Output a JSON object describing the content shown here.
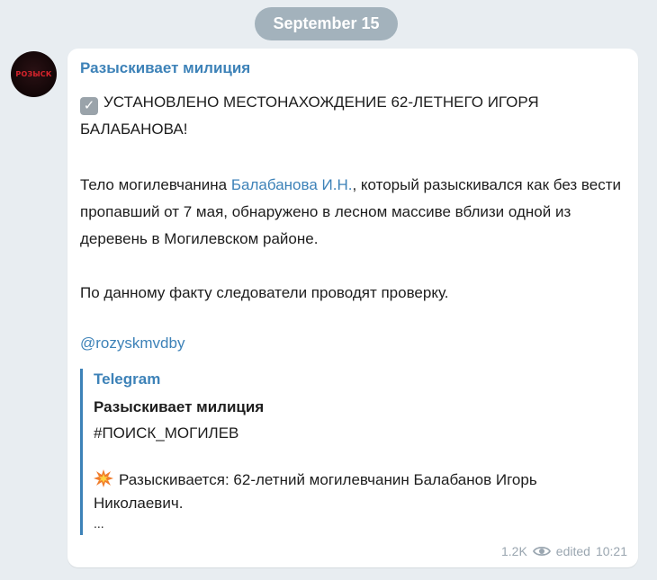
{
  "date_divider": "September 15",
  "channel": {
    "avatar_text": "РОЗЫСК",
    "name": "Разыскивает милиция"
  },
  "message": {
    "headline": "УСТАНОВЛЕНО МЕСТОНАХОЖДЕНИЕ 62-ЛЕТНЕГО ИГОРЯ БАЛАБАНОВА!",
    "p1_before": "Тело могилевчанина ",
    "p1_link": "Балабанова И.Н.",
    "p1_after": ", который разыскивался как без вести пропавший от 7 мая, обнаружено в лесном массиве вблизи одной из деревень в Могилевском районе.",
    "p2": "По данному факту следователи проводят проверку.",
    "channel_link": "@rozyskmvdby"
  },
  "preview": {
    "source": "Telegram",
    "title": "Разыскивает милиция",
    "hashtag": "#ПОИСК_МОГИЛЕВ",
    "text": "Разыскивается: 62-летний могилевчанин Балабанов Игорь Николаевич.",
    "ellipsis": "..."
  },
  "footer": {
    "views": "1.2K",
    "edited": "edited",
    "time": "10:21"
  },
  "colors": {
    "accent": "#3d82b8",
    "background": "#e8edf1",
    "date_pill": "#a3b2bc",
    "meta": "#9aa6b0"
  },
  "icons": {
    "check": "check-mark-button-icon",
    "explosion": "collision-icon",
    "views": "eye-icon"
  }
}
